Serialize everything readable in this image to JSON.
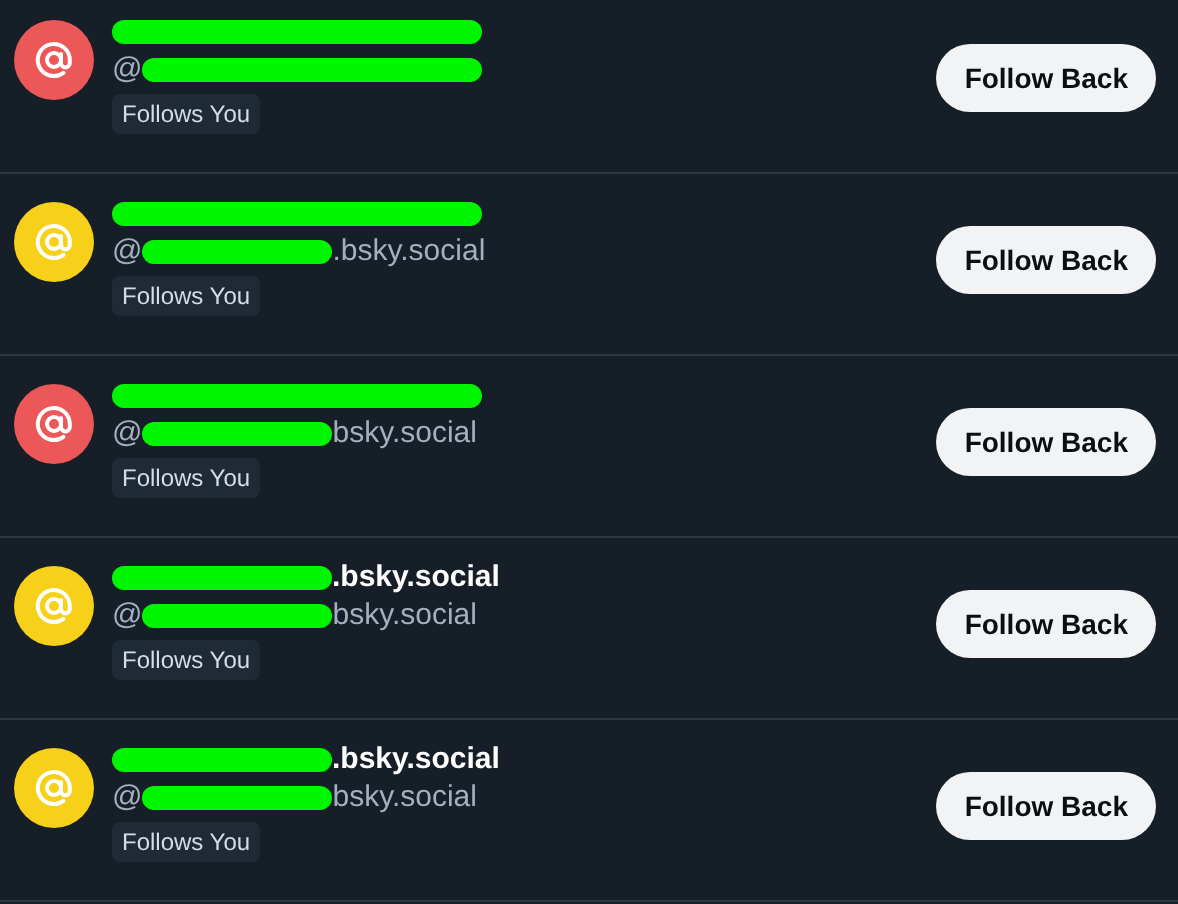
{
  "followers": [
    {
      "color": "#ec5757",
      "handle_prefix": "@",
      "badge": "Follows You",
      "button": "Follow Back"
    },
    {
      "color": "#f7d019",
      "handle_prefix": "@",
      "handle_suffix": ".bsky.social",
      "badge": "Follows You",
      "button": "Follow Back"
    },
    {
      "color": "#ec5757",
      "handle_prefix": "@",
      "handle_suffix": "bsky.social",
      "badge": "Follows You",
      "button": "Follow Back"
    },
    {
      "color": "#f7d019",
      "name_suffix": ".bsky.social",
      "handle_prefix": "@",
      "handle_suffix": "bsky.social",
      "badge": "Follows You",
      "button": "Follow Back"
    },
    {
      "color": "#f7d019",
      "name_suffix": ".bsky.social",
      "handle_prefix": "@",
      "handle_suffix": "bsky.social",
      "badge": "Follows You",
      "button": "Follow Back"
    }
  ]
}
